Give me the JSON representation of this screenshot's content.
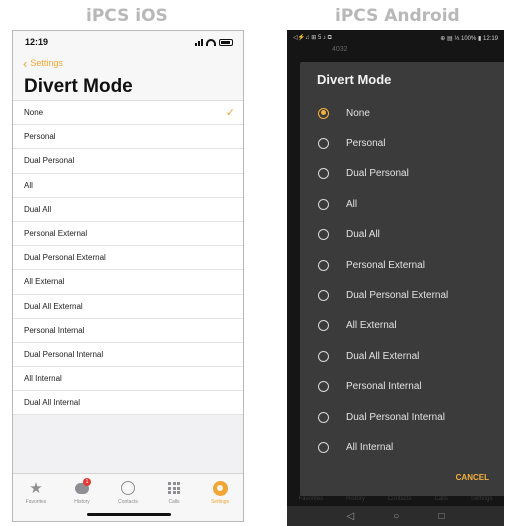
{
  "captions": {
    "ios": "iPCS iOS",
    "android": "iPCS Android"
  },
  "ios": {
    "time": "12:19",
    "back_label": "Settings",
    "title": "Divert Mode",
    "selected": "None",
    "options": [
      "None",
      "Personal",
      "Dual Personal",
      "All",
      "Dual All",
      "Personal External",
      "Dual Personal External",
      "All External",
      "Dual All External",
      "Personal Internal",
      "Dual Personal Internal",
      "All Internal",
      "Dual All Internal"
    ],
    "tabs": [
      {
        "label": "Favorites",
        "icon": "star-icon",
        "active": false
      },
      {
        "label": "History",
        "icon": "history-icon",
        "active": false,
        "badge": "1"
      },
      {
        "label": "Contacts",
        "icon": "contacts-icon",
        "active": false
      },
      {
        "label": "Calls",
        "icon": "keypad-icon",
        "active": false
      },
      {
        "label": "Settings",
        "icon": "settings-icon",
        "active": true
      }
    ],
    "accent": "#f2a533"
  },
  "android": {
    "status_left": "◁⚡♫ ⊞ 5 ♪ ⧉",
    "status_right": "⊕ ▤ ⅓ 100% ▮ 12:19",
    "background_number": "4032",
    "dialog_title": "Divert Mode",
    "selected": "None",
    "options": [
      "None",
      "Personal",
      "Dual Personal",
      "All",
      "Dual All",
      "Personal External",
      "Dual Personal External",
      "All External",
      "Dual All External",
      "Personal Internal",
      "Dual Personal Internal",
      "All Internal"
    ],
    "cancel_label": "CANCEL",
    "background_tabs": [
      "Favorites",
      "History",
      "Contacts",
      "Calls",
      "Settings"
    ],
    "nav_buttons": [
      "◁",
      "○",
      "□"
    ],
    "accent": "#f4b23c"
  }
}
